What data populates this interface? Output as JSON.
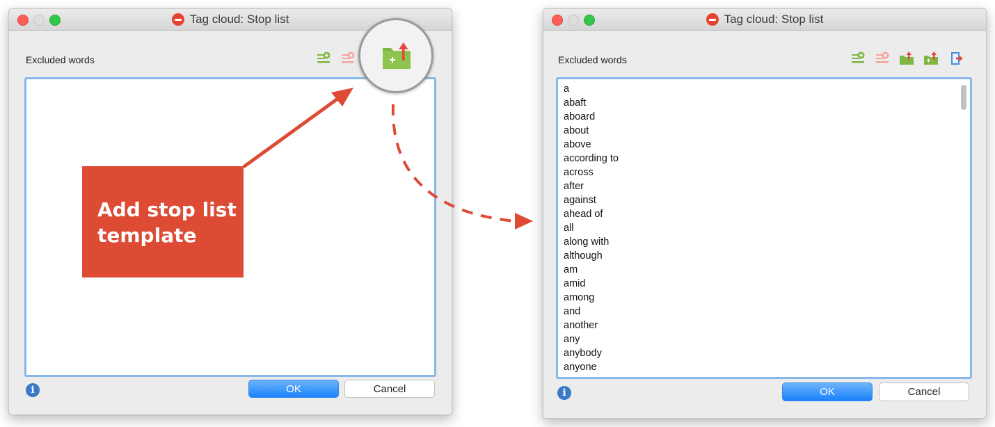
{
  "left_window": {
    "title": "Tag cloud: Stop list",
    "label": "Excluded words",
    "ok_label": "OK",
    "cancel_label": "Cancel",
    "toolbar": [
      "add-word-icon",
      "remove-word-icon",
      "add-template-icon"
    ]
  },
  "right_window": {
    "title": "Tag cloud: Stop list",
    "label": "Excluded words",
    "ok_label": "OK",
    "cancel_label": "Cancel",
    "toolbar": [
      "add-word-icon",
      "remove-word-icon",
      "import-icon",
      "add-template-icon",
      "export-icon"
    ],
    "words": [
      "a",
      "abaft",
      "aboard",
      "about",
      "above",
      "according to",
      "across",
      "after",
      "against",
      "ahead of",
      "all",
      "along with",
      "although",
      "am",
      "amid",
      "among",
      "and",
      "another",
      "any",
      "anybody",
      "anyone"
    ]
  },
  "callout": {
    "line1": "Add stop list",
    "line2": "template"
  },
  "colors": {
    "accent_blue": "#1a82fb",
    "callout_red": "#dd4b35",
    "icon_green": "#7fb644",
    "icon_red": "#e24a3b"
  }
}
